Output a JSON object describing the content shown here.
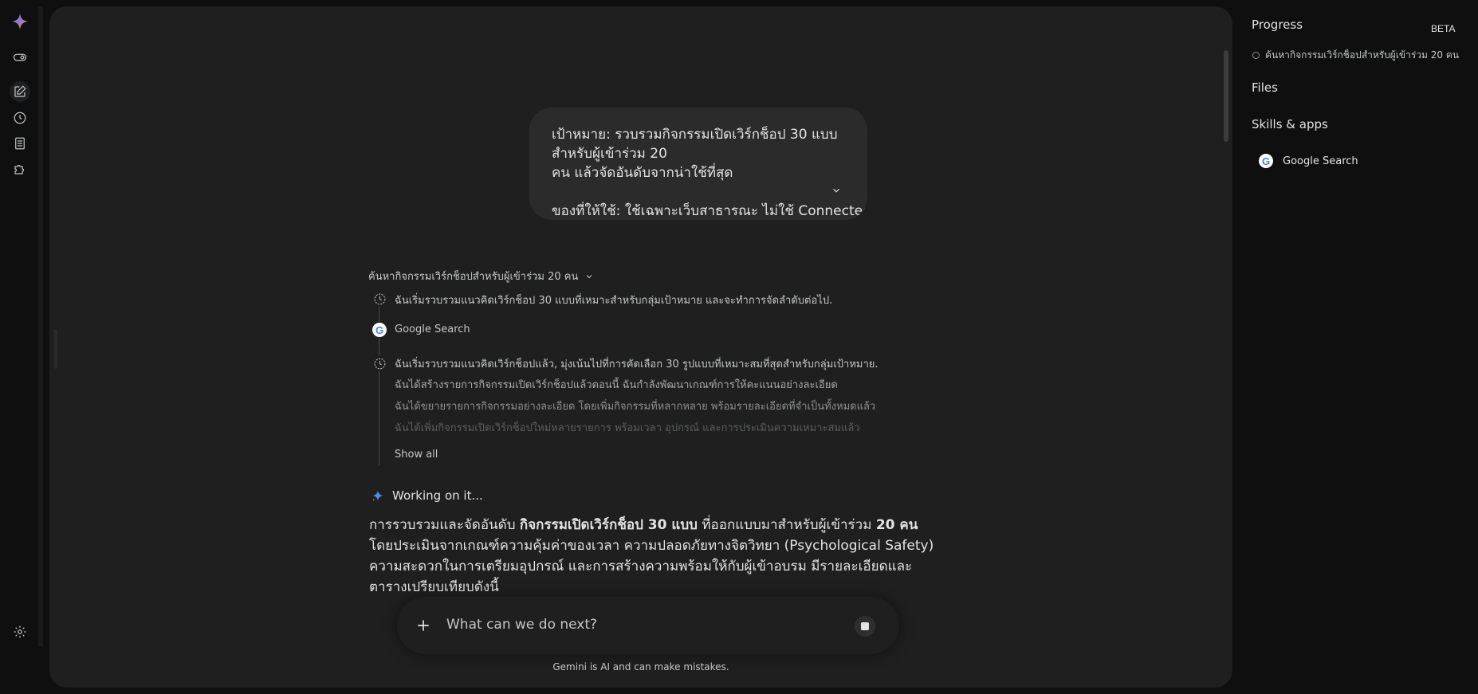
{
  "colors": {
    "background": "#0f0f10",
    "panel": "#1f1f1f",
    "bubble": "#2b2b2b",
    "text": "#e3e3e3",
    "muted": "#c4c7c5"
  },
  "rail": {
    "icons": [
      "gemini-logo-icon",
      "toggle-icon",
      "new-chat-icon",
      "history-icon",
      "library-icon",
      "extensions-icon",
      "settings-icon"
    ]
  },
  "user_message": {
    "line1": "เป้าหมาย: รวบรวมกิจกรรมเปิดเวิร์กช็อป 30 แบบสำหรับผู้เข้าร่วม 20",
    "line2": "คน แล้วจัดอันดับจากน่าใช้ที่สุด",
    "line3": "ของที่ให้ใช้: ใช้เฉพาะเว็บสาธารณะ ไม่ใช้ Connected Apps หรือไ"
  },
  "task": {
    "title": "ค้นหากิจกรรมเวิร์กช็อปสำหรับผู้เข้าร่วม 20 คน",
    "steps": [
      "ฉันเริ่มรวบรวมแนวคิดเวิร์กช็อป 30 แบบที่เหมาะสำหรับกลุ่มเป้าหมาย และจะทำการจัดลำดับต่อไป.",
      "Google Search",
      "ฉันเริ่มรวบรวมแนวคิดเวิร์กช็อปแล้ว, มุ่งเน้นไปที่การคัดเลือก 30 รูปแบบที่เหมาะสมที่สุดสำหรับกลุ่มเป้าหมาย.",
      "ฉันได้สร้างรายการกิจกรรมเปิดเวิร์กช็อปแล้วตอนนี้ ฉันกำลังพัฒนาเกณฑ์การให้คะแนนอย่างละเอียด",
      "ฉันได้ขยายรายการกิจกรรมอย่างละเอียด โดยเพิ่มกิจกรรมที่หลากหลาย พร้อมรายละเอียดที่จำเป็นทั้งหมดแล้ว",
      "ฉันได้เพิ่มกิจกรรมเปิดเวิร์กช็อปใหม่หลายรายการ พร้อมเวลา อุปกรณ์ และการประเมินความเหมาะสมแล้ว"
    ],
    "show_all": "Show all"
  },
  "status": {
    "working": "Working on it..."
  },
  "answer": {
    "p1": "การรวบรวมและจัดอันดับ ",
    "b1": "กิจกรรมเปิดเวิร์กช็อป 30 แบบ",
    "p2": " ที่ออกแบบมาสำหรับผู้เข้าร่วม ",
    "b2": "20 คน",
    "p3": " โดยประเมินจากเกณฑ์ความคุ้มค่าของเวลา ความปลอดภัยทางจิตวิทยา (Psychological Safety) ความสะดวกในการเตรียมอุปกรณ์ และการสร้างความพร้อมให้กับผู้เข้าอบรม มีรายละเอียดและตารางเปรียบเทียบดังนี้"
  },
  "input": {
    "placeholder": "What can we do next?"
  },
  "disclaimer": "Gemini is AI and can make mistakes.",
  "right_panel": {
    "progress_title": "Progress",
    "beta": "BETA",
    "progress_items": [
      "ค้นหากิจกรรมเวิร์กช็อปสำหรับผู้เข้าร่วม 20 คน"
    ],
    "files_title": "Files",
    "skills_title": "Skills & apps",
    "skills": [
      "Google Search"
    ]
  }
}
